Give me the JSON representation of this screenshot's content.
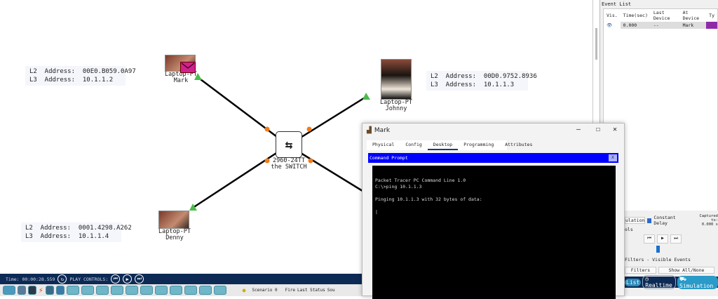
{
  "devices": [
    {
      "model": "Laptop-PT",
      "name": "Mark",
      "l2": "00E0.B059.0A97",
      "l3": "10.1.1.2"
    },
    {
      "model": "Laptop-PT",
      "name": "Johnny",
      "l2": "00D0.9752.8936",
      "l3": "10.1.1.3"
    },
    {
      "model": "Laptop-PT",
      "name": "Denny",
      "l2": "0001.4298.A262",
      "l3": "10.1.1.4"
    },
    {
      "model": "2960-24TT",
      "name": "the SWITCH"
    }
  ],
  "labels": {
    "l2": "L2  Address:",
    "l3": "L3  Address:"
  },
  "event_list": {
    "title": "Event List",
    "columns": [
      "Vis.",
      "Time(sec)",
      "Last Device",
      "At Device",
      "Ty"
    ],
    "rows": [
      {
        "time": "0.000",
        "last": "--",
        "at": "Mark",
        "type_color": "#8e2aa8"
      }
    ]
  },
  "sim": {
    "simulation_trunc": "ulation",
    "constant_delay": "Constant Delay",
    "captured_label": "Captured to:",
    "captured_value": "0.000 s",
    "controls_trunc": "ols",
    "filters_title": "Filters - Visible Events",
    "filters_btn": "Filters",
    "show_all": "Show All/None",
    "list_trunc": "List",
    "realtime": "Realtime",
    "simulation": "Simulation"
  },
  "bottom": {
    "time": "Time: 00:00:28.559",
    "play_controls": "PLAY CONTROLS:",
    "scenario": "Scenario 0",
    "fire": "Fire",
    "last_status": "Last Status",
    "source": "Sou"
  },
  "window": {
    "title": "Mark",
    "tabs": [
      "Physical",
      "Config",
      "Desktop",
      "Programming",
      "Attributes"
    ],
    "active_tab": "Desktop",
    "app_title": "Command Prompt",
    "close": "X",
    "terminal": "\nPacket Tracer PC Command Line 1.0\nC:\\>ping 10.1.1.3\n\nPinging 10.1.1.3 with 32 bytes of data:\n\n|"
  }
}
